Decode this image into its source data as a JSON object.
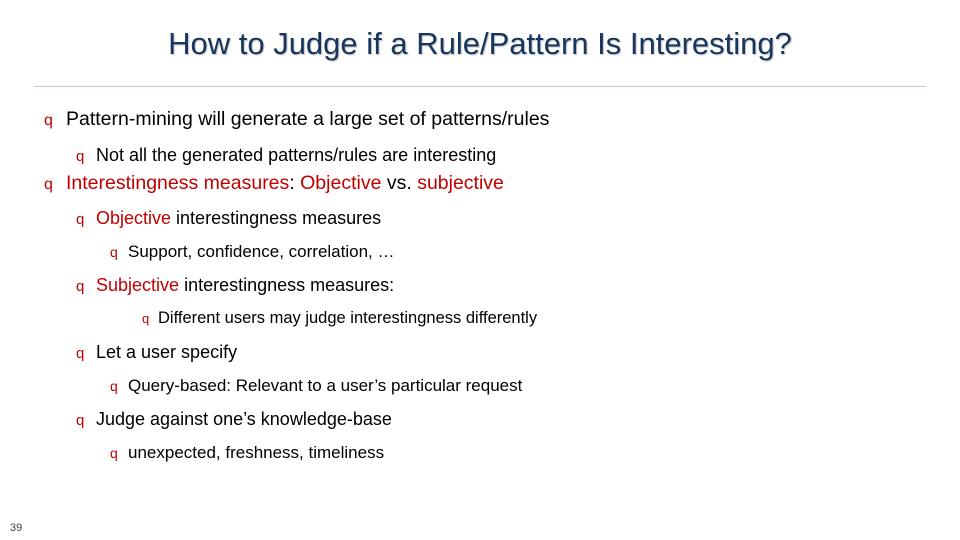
{
  "slide": {
    "title": "How to Judge if a Rule/Pattern Is Interesting?",
    "page_number": "39",
    "bullet_glyph": "q",
    "colors": {
      "title": "#17365D",
      "bullet": "#C00000",
      "accent_red": "#C00000",
      "body_text": "#000000",
      "rule": "#B8CCE4"
    },
    "lines": [
      {
        "level": 1,
        "segments": [
          {
            "text": "Pattern-mining will generate a large set of patterns/rules",
            "color": "black"
          }
        ]
      },
      {
        "level": 2,
        "segments": [
          {
            "text": "Not all the generated patterns/rules are interesting",
            "color": "black"
          }
        ]
      },
      {
        "level": 1,
        "segments": [
          {
            "text": "Interestingness measures",
            "color": "red"
          },
          {
            "text": ": ",
            "color": "black"
          },
          {
            "text": "Objective",
            "color": "red"
          },
          {
            "text": " vs. ",
            "color": "black"
          },
          {
            "text": "subjective",
            "color": "red"
          }
        ]
      },
      {
        "level": 2,
        "segments": [
          {
            "text": "Objective",
            "color": "red"
          },
          {
            "text": " interestingness measures",
            "color": "black"
          }
        ]
      },
      {
        "level": 3,
        "segments": [
          {
            "text": "Support, confidence, correlation, …",
            "color": "black"
          }
        ]
      },
      {
        "level": 2,
        "segments": [
          {
            "text": "Subjective",
            "color": "red"
          },
          {
            "text": " interestingness measures:",
            "color": "black"
          }
        ]
      },
      {
        "level": 4,
        "segments": [
          {
            "text": "Different users may judge interestingness differently",
            "color": "black"
          }
        ]
      },
      {
        "level": 2,
        "segments": [
          {
            "text": "Let a user specify",
            "color": "black"
          }
        ]
      },
      {
        "level": 3,
        "segments": [
          {
            "text": "Query-based:  Relevant to a user’s particular request",
            "color": "black"
          }
        ]
      },
      {
        "level": 2,
        "segments": [
          {
            "text": "Judge against one’s knowledge-base",
            "color": "black"
          }
        ]
      },
      {
        "level": 3,
        "segments": [
          {
            "text": "unexpected, freshness, timeliness",
            "color": "black"
          }
        ]
      }
    ]
  }
}
